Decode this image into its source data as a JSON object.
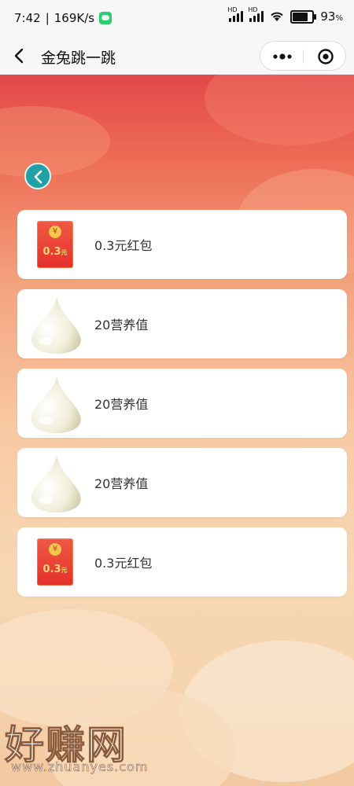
{
  "statusbar": {
    "time": "7:42",
    "speed": "169K/s",
    "signal_1_label": "HD",
    "signal_2_label": "HD",
    "battery_percent": "93",
    "battery_level": 0.93
  },
  "titlebar": {
    "title": "金兔跳一跳"
  },
  "rewards": [
    {
      "type": "red-packet",
      "label": "0.3元红包",
      "amount": "0.3",
      "unit": "元"
    },
    {
      "type": "nutrition",
      "label": "20营养值"
    },
    {
      "type": "nutrition",
      "label": "20营养值"
    },
    {
      "type": "nutrition",
      "label": "20营养值"
    },
    {
      "type": "red-packet",
      "label": "0.3元红包",
      "amount": "0.3",
      "unit": "元"
    }
  ],
  "watermark": {
    "brand": "好赚网",
    "url": "www.zhuanyes.com"
  },
  "colors": {
    "header_red": "#e2484a",
    "back_button_teal": "#21a0a6",
    "red_packet": "#e4302b"
  }
}
